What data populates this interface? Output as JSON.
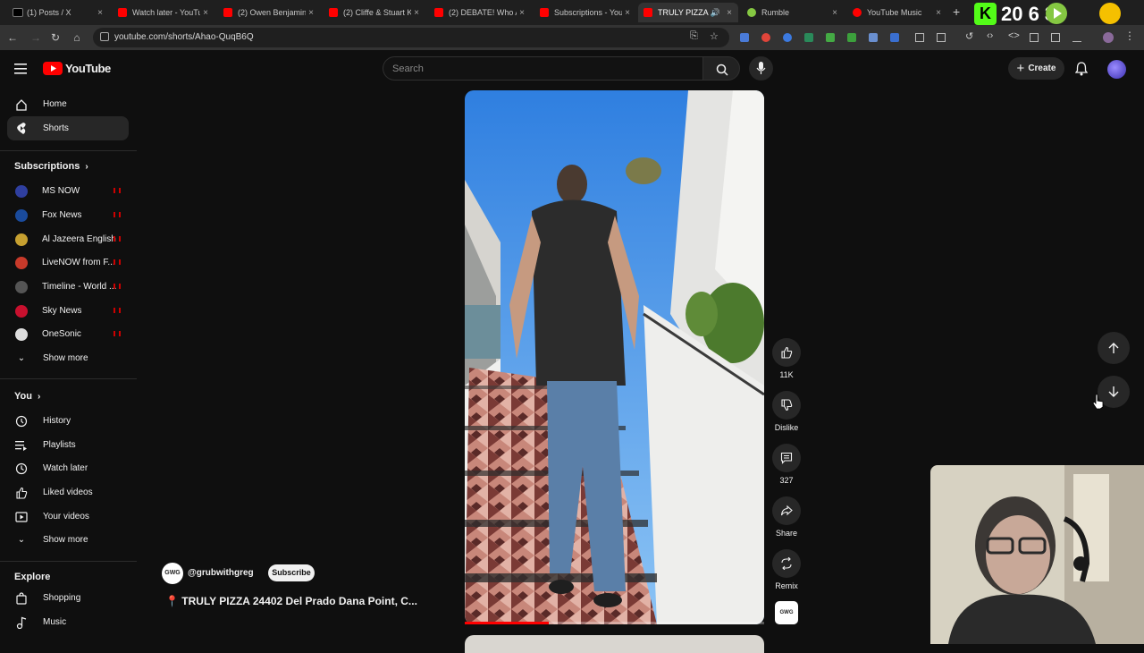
{
  "browser": {
    "tabs": [
      {
        "label": "(1) Posts / X",
        "icon": "x-logo-icon"
      },
      {
        "label": "Watch later - YouTube",
        "icon": "youtube-icon"
      },
      {
        "label": "(2) Owen Benjamin",
        "icon": "youtube-icon"
      },
      {
        "label": "(2) Cliffe & Stuart K",
        "icon": "youtube-icon"
      },
      {
        "label": "(2) DEBATE! Who Ar",
        "icon": "youtube-icon"
      },
      {
        "label": "Subscriptions - You",
        "icon": "youtube-icon"
      },
      {
        "label": "TRULY PIZZA",
        "icon": "youtube-icon",
        "active": true
      },
      {
        "label": "Rumble",
        "icon": "rumble-icon"
      },
      {
        "label": "YouTube Music",
        "icon": "youtube-music-icon"
      }
    ],
    "url": "youtube.com/shorts/Ahao-QuqB6Q",
    "overlay_counter": "20  6  3"
  },
  "youtube": {
    "logo": "YouTube",
    "search_placeholder": "Search",
    "create_label": "Create",
    "nav": {
      "home": "Home",
      "shorts": "Shorts"
    },
    "subscriptions": {
      "heading": "Subscriptions",
      "items": [
        {
          "label": "MS NOW",
          "color": "#2f3f9f"
        },
        {
          "label": "Fox News",
          "color": "#1a4b9c"
        },
        {
          "label": "Al Jazeera English",
          "color": "#c6a030"
        },
        {
          "label": "LiveNOW from F...",
          "color": "#c83a2a"
        },
        {
          "label": "Timeline - World ...",
          "color": "#555555"
        },
        {
          "label": "Sky News",
          "color": "#c8102e"
        },
        {
          "label": "OneSonic",
          "color": "#dddddd"
        }
      ],
      "show_more": "Show more"
    },
    "you": {
      "heading": "You",
      "items": [
        {
          "label": "History",
          "icon": "history-icon"
        },
        {
          "label": "Playlists",
          "icon": "playlists-icon"
        },
        {
          "label": "Watch later",
          "icon": "watch-later-icon"
        },
        {
          "label": "Liked videos",
          "icon": "thumbs-up-icon"
        },
        {
          "label": "Your videos",
          "icon": "your-videos-icon"
        }
      ],
      "show_more": "Show more"
    },
    "explore": {
      "heading": "Explore",
      "items": [
        {
          "label": "Shopping",
          "icon": "shopping-bag-icon"
        },
        {
          "label": "Music",
          "icon": "music-note-icon"
        }
      ]
    },
    "short": {
      "channel_handle": "@grubwithgreg",
      "channel_avatar_text": "GWG",
      "subscribe_label": "Subscribe",
      "title": "📍 TRULY PIZZA 24402 Del Prado Dana Point, C...",
      "likes": "11K",
      "dislike_label": "Dislike",
      "comments": "327",
      "share_label": "Share",
      "remix_label": "Remix",
      "progress": 0.28
    }
  }
}
